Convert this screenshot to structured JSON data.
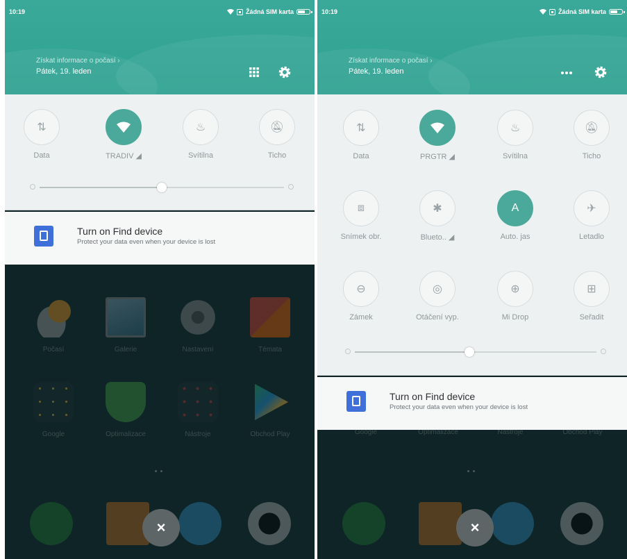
{
  "left": {
    "status": {
      "time": "10:19",
      "sim": "Žádná SIM karta"
    },
    "header": {
      "weather_link": "Získat informace o počasí ›",
      "date": "Pátek, 19. leden"
    },
    "tiles": [
      {
        "label": "Data",
        "icon": "data-icon",
        "on": false
      },
      {
        "label": "TRADIV ◢",
        "icon": "wifi-icon",
        "on": true
      },
      {
        "label": "Svítilna",
        "icon": "flashlight-icon",
        "on": false
      },
      {
        "label": "Ticho",
        "icon": "silent-icon",
        "on": false
      }
    ],
    "brightness": 0.54,
    "notification": {
      "title": "Turn on Find device",
      "subtitle": "Protect your data even when your device is lost"
    },
    "apps_row1": [
      "Počasí",
      "Galerie",
      "Nastavení",
      "Témata"
    ],
    "apps_row2": [
      "Google",
      "Optimalizace",
      "Nástroje",
      "Obchod Play"
    ]
  },
  "right": {
    "status": {
      "time": "10:19",
      "sim": "Žádná SIM karta"
    },
    "header": {
      "weather_link": "Získat informace o počasí ›",
      "date": "Pátek, 19. leden"
    },
    "tiles": [
      {
        "label": "Data",
        "icon": "data-icon",
        "on": false
      },
      {
        "label": "PRGTR ◢",
        "icon": "wifi-icon",
        "on": true
      },
      {
        "label": "Svítilna",
        "icon": "flashlight-icon",
        "on": false
      },
      {
        "label": "Ticho",
        "icon": "silent-icon",
        "on": false
      },
      {
        "label": "Snímek obr.",
        "icon": "screenshot-icon",
        "on": false
      },
      {
        "label": "Blueto.. ◢",
        "icon": "bluetooth-icon",
        "on": false
      },
      {
        "label": "Auto. jas",
        "icon": "auto-brightness-icon",
        "on": true
      },
      {
        "label": "Letadlo",
        "icon": "airplane-icon",
        "on": false
      },
      {
        "label": "Zámek",
        "icon": "lock-icon",
        "on": false
      },
      {
        "label": "Otáčení vyp.",
        "icon": "rotation-icon",
        "on": false
      },
      {
        "label": "Mi Drop",
        "icon": "midrop-icon",
        "on": false
      },
      {
        "label": "Seřadit",
        "icon": "sort-icon",
        "on": false
      }
    ],
    "brightness": 0.47,
    "notification": {
      "title": "Turn on Find device",
      "subtitle": "Protect your data even when your device is lost"
    },
    "apps_row2": [
      "Google",
      "Optimalizace",
      "Nástroje",
      "Obchod Play"
    ]
  },
  "close_symbol": "×",
  "colors": {
    "accent": "#4aa99a",
    "header": "#33a594",
    "panel": "#eef1f2",
    "home_bg": "#0e2427"
  }
}
